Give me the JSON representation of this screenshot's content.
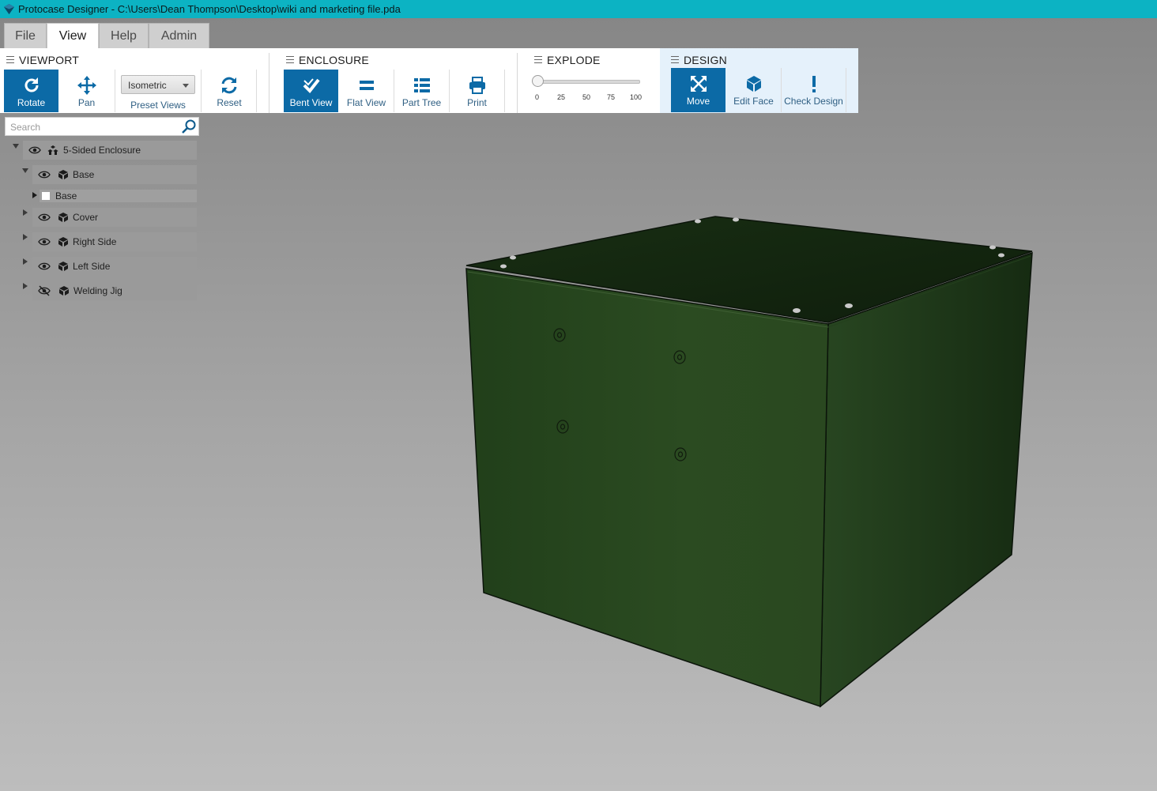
{
  "window": {
    "title": "Protocase Designer - C:\\Users\\Dean Thompson\\Desktop\\wiki and marketing file.pda",
    "titlebar_color": "#0cb3c3"
  },
  "menu_tabs": [
    {
      "label": "File",
      "active": false
    },
    {
      "label": "View",
      "active": true
    },
    {
      "label": "Help",
      "active": false
    },
    {
      "label": "Admin",
      "active": false
    }
  ],
  "ribbon": {
    "accent": "#0c6aa6",
    "viewport": {
      "title": "VIEWPORT",
      "rotate_label": "Rotate",
      "pan_label": "Pan",
      "preset_value": "Isometric",
      "preset_label": "Preset Views",
      "reset_label": "Reset"
    },
    "enclosure": {
      "title": "ENCLOSURE",
      "bent_view_label": "Bent View",
      "flat_view_label": "Flat View",
      "part_tree_label": "Part Tree",
      "print_label": "Print"
    },
    "explode": {
      "title": "EXPLODE",
      "value": 0,
      "ticks": [
        "0",
        "25",
        "50",
        "75",
        "100"
      ]
    },
    "design": {
      "title": "DESIGN",
      "move_label": "Move",
      "edit_face_label": "Edit Face",
      "check_design_label": "Check Design"
    }
  },
  "search": {
    "placeholder": "Search",
    "value": ""
  },
  "tree": {
    "root_label": "5-Sided Enclosure",
    "base_label": "Base",
    "base_child_label": "Base",
    "cover_label": "Cover",
    "right_side_label": "Right Side",
    "left_side_label": "Left Side",
    "welding_jig_label": "Welding Jig"
  },
  "model": {
    "panel_color": "#2b4a20"
  }
}
